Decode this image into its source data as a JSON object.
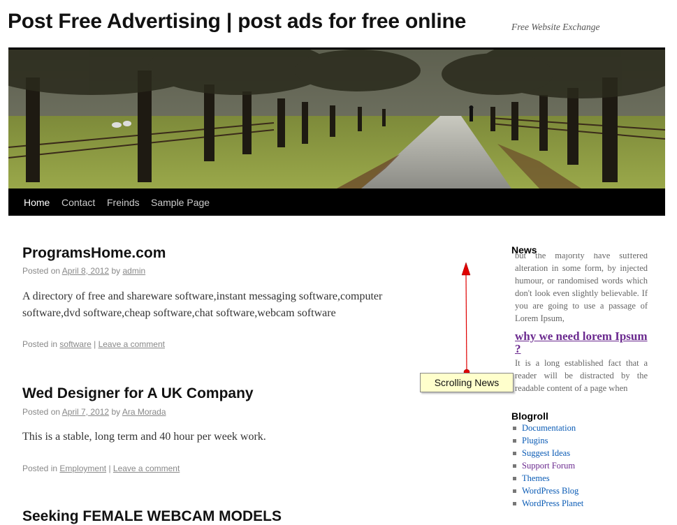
{
  "site": {
    "title": "Post Free Advertising | post ads for free online",
    "description": "Free Website Exchange"
  },
  "nav": {
    "items": [
      "Home",
      "Contact",
      "Freinds",
      "Sample Page"
    ],
    "active": "Home"
  },
  "posts": [
    {
      "title": "ProgramsHome.com",
      "posted_on": "Posted on",
      "date": "April 8, 2012",
      "by": "by",
      "author": "admin",
      "body": "A directory of free and shareware software,instant messaging software,computer software,dvd software,cheap software,chat software,webcam software",
      "posted_in": "Posted in",
      "category": "software",
      "separator": "|",
      "comment_link": "Leave a comment"
    },
    {
      "title": "Wed Designer for A UK Company",
      "posted_on": "Posted on",
      "date": "April 7, 2012",
      "by": "by",
      "author": "Ara Morada",
      "body": "This is a stable, long term and 40 hour per week work.",
      "posted_in": "Posted in",
      "category": "Employment",
      "separator": "|",
      "comment_link": "Leave a comment"
    },
    {
      "title": "Seeking FEMALE WEBCAM MODELS"
    }
  ],
  "sidebar": {
    "news_title": "News",
    "news_text_1": "but the majority have suffered alteration in some form, by injected humour, or randomised words which don't look even slightly believable. If you are going to use a passage of Lorem Ipsum,",
    "news_heading": "why we need lorem Ipsum ?",
    "news_text_2": "It is a long established fact that a reader will be distracted by the readable content of a page when",
    "blogroll_title": "Blogroll",
    "blogroll": [
      {
        "label": "Documentation"
      },
      {
        "label": "Plugins"
      },
      {
        "label": "Suggest Ideas"
      },
      {
        "label": "Support Forum"
      },
      {
        "label": "Themes"
      },
      {
        "label": "WordPress Blog"
      },
      {
        "label": "WordPress Planet"
      }
    ]
  },
  "annotation": {
    "label": "Scrolling News"
  },
  "colors": {
    "link": "#0a5bb5",
    "visited": "#6b2a8f",
    "nav_bg": "#000000",
    "callout_bg": "#ffffcc",
    "arrow": "#e00000"
  }
}
